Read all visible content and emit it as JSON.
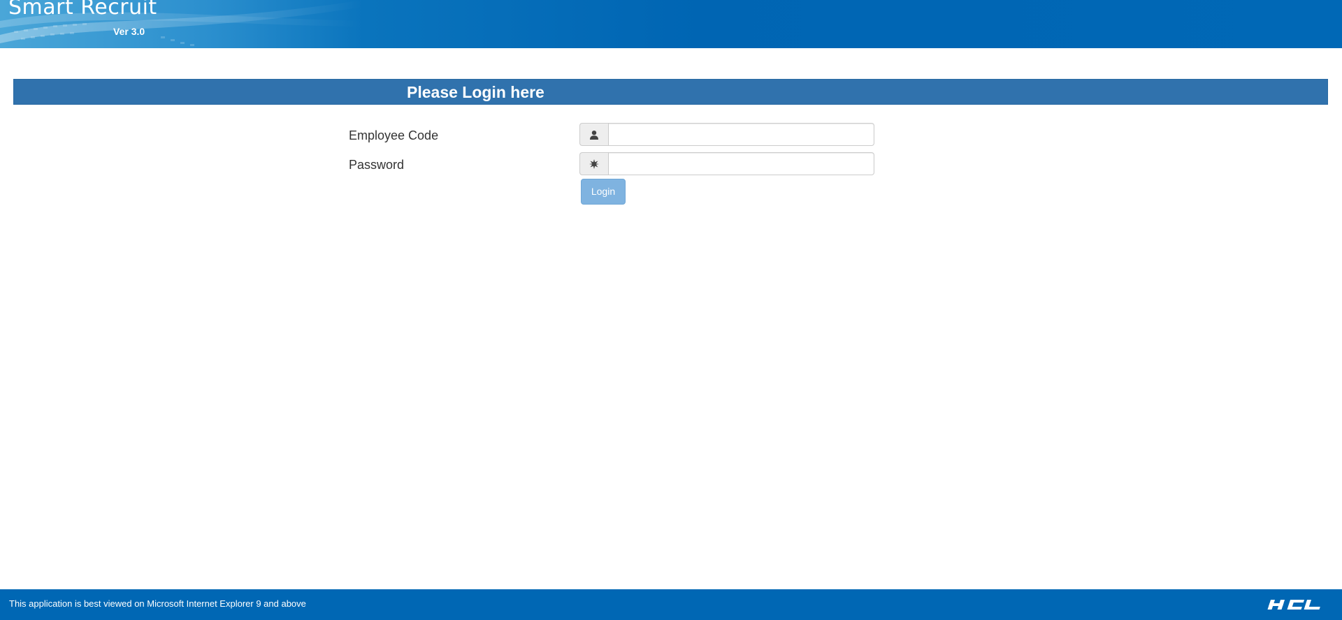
{
  "header": {
    "title": "Smart Recruit",
    "version": "Ver 3.0"
  },
  "login_panel": {
    "title": "Please Login here",
    "employee_code": {
      "label": "Employee Code",
      "value": "",
      "icon": "user-icon"
    },
    "password": {
      "label": "Password",
      "value": "",
      "icon": "asterisk-icon"
    },
    "login_label": "Login"
  },
  "footer": {
    "note": "This application is best viewed on Microsoft Internet Explorer 9 and above",
    "brand": "HCL"
  },
  "colors": {
    "header_blue": "#0065b3",
    "panel_bar": "#3072ad",
    "login_button": "#7fb3e0",
    "footer_blue": "#0067b4"
  }
}
